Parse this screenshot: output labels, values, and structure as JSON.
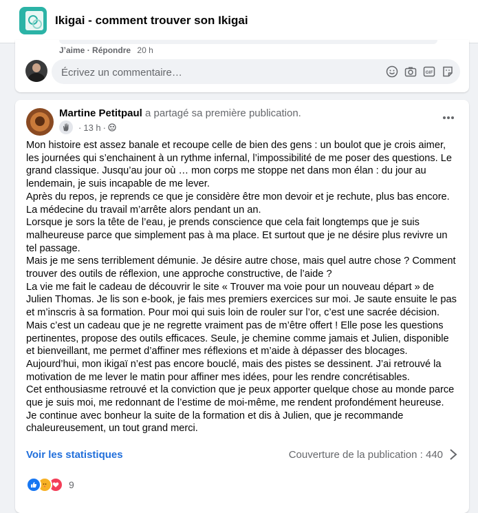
{
  "header": {
    "group_title": "Ikigai - comment trouver son Ikigai"
  },
  "previous_comment": {
    "like_label": "J’aime",
    "reply_label": "Répondre",
    "time": "20 h"
  },
  "comment_composer": {
    "placeholder": "Écrivez un commentaire…",
    "icons": [
      "emoji-icon",
      "camera-icon",
      "gif-icon",
      "sticker-icon"
    ]
  },
  "post": {
    "author": "Martine Petitpaul",
    "action_text": "a partagé sa première publication.",
    "time": "13 h",
    "separator": "·",
    "body": [
      "Mon histoire est assez banale et recoupe celle de bien des gens : un boulot que je crois aimer, les journées qui s’enchainent à un rythme infernal, l’impossibilité de me poser des questions. Le grand classique. Jusqu’au jour où … mon corps me stoppe net dans mon élan : du jour au lendemain, je suis incapable de me lever.",
      "Après du repos, je reprends ce que je considère être mon devoir et je rechute, plus bas encore. La médecine du travail m’arrête alors pendant un an.",
      "Lorsque je sors la tête de l’eau, je prends conscience que cela fait longtemps que je suis malheureuse parce que simplement pas à ma place. Et surtout que je ne désire plus revivre un tel passage.",
      "Mais je me sens terriblement démunie. Je désire autre chose, mais quel autre chose ? Comment trouver des outils de réflexion, une approche constructive, de l’aide ?",
      "La vie me fait le cadeau de découvrir le site « Trouver ma voie pour un nouveau départ » de Julien Thomas. Je lis son e-book, je fais mes premiers exercices sur moi. Je saute ensuite le pas et m’inscris à sa formation. Pour moi qui suis loin de rouler sur l’or, c’est une sacrée décision. Mais c’est un cadeau que je ne regrette vraiment pas de m’être offert ! Elle pose les questions pertinentes, propose des outils efficaces. Seule, je chemine comme jamais et Julien, disponible et bienveillant, me permet d’affiner mes réflexions et m’aide à dépasser des blocages.",
      "Aujourd’hui, mon ikigaï n’est pas encore bouclé, mais des pistes se dessinent. J’ai retrouvé la motivation de me lever le matin pour affiner mes idées, pour les rendre concrétisables.",
      "Cet enthousiasme retrouvé et la conviction que je peux apporter quelque chose au monde parce que je suis moi, me redonnant de l’estime de moi-même, me rendent profondément heureuse.",
      "Je continue avec bonheur la suite de la formation et dis à Julien, que je recommande chaleureusement, un tout grand merci."
    ],
    "stats_link": "Voir les statistiques",
    "reach_text": "Couverture de la publication : 440",
    "reaction_count": "9",
    "colors": {
      "link_blue": "#216fdb",
      "like_blue": "#1877f2",
      "care_yellow": "#f7b125",
      "love_red": "#f33e58"
    }
  }
}
